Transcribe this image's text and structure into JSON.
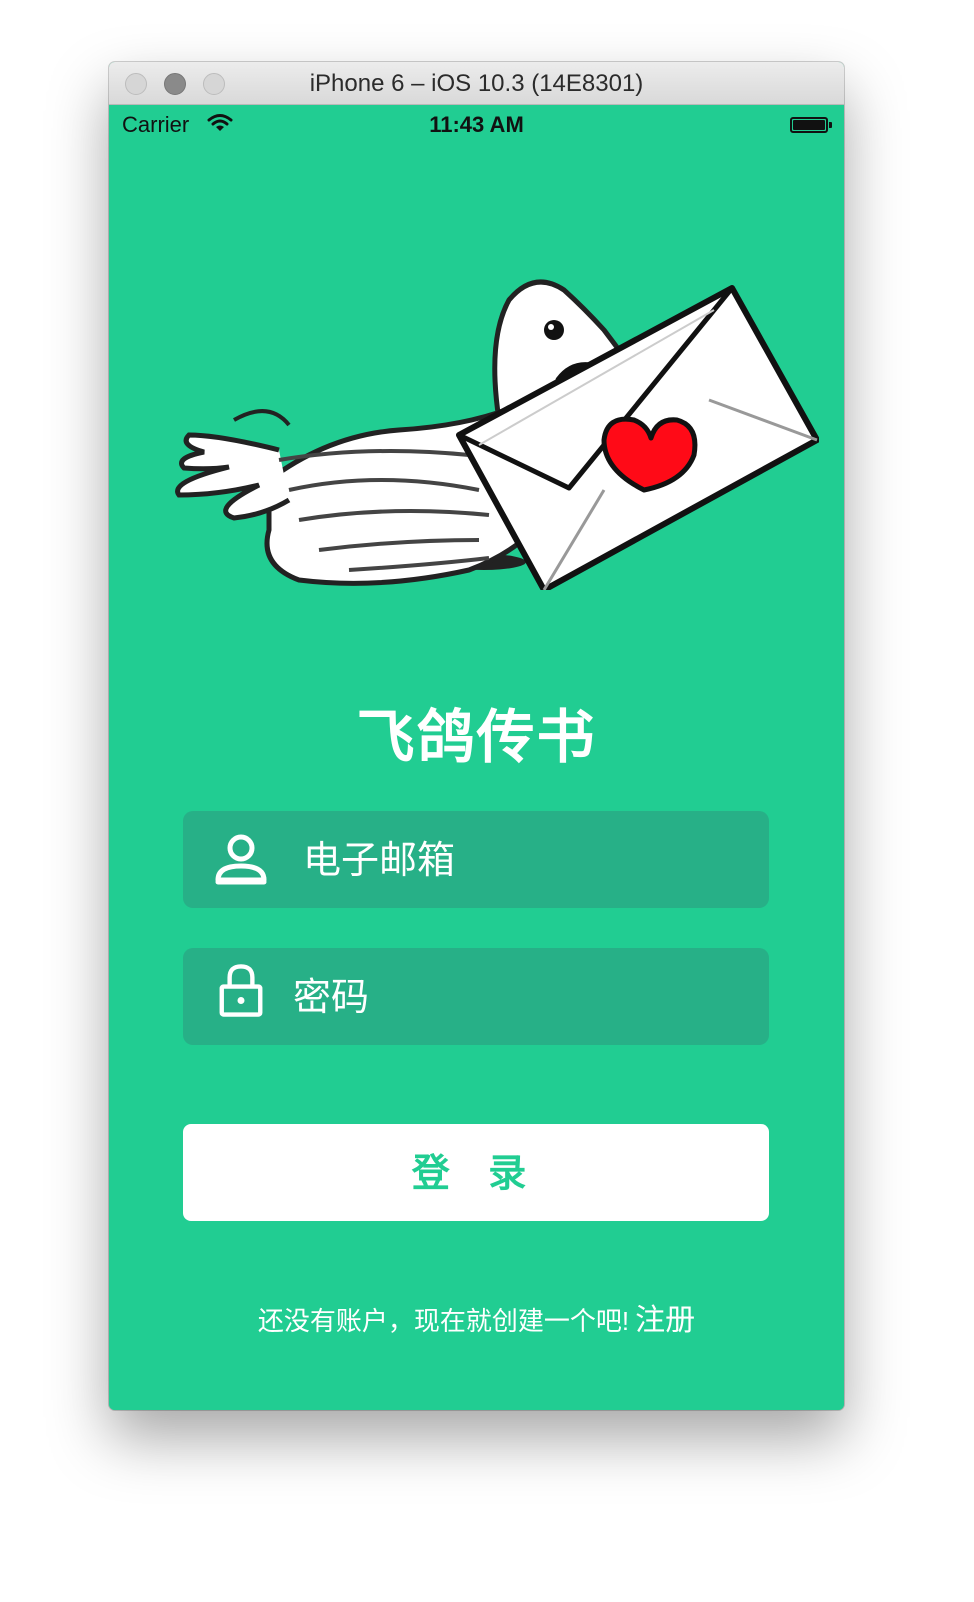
{
  "window": {
    "title": "iPhone 6 – iOS 10.3 (14E8301)"
  },
  "status_bar": {
    "carrier": "Carrier",
    "time": "11:43 AM"
  },
  "app": {
    "title": "飞鸽传书",
    "email_field": {
      "placeholder": "电子邮箱",
      "icon": "user-icon"
    },
    "password_field": {
      "placeholder": "密码",
      "icon": "lock-icon"
    },
    "login_button": "登 录",
    "signup_prompt": "还没有账户，现在就创建一个吧!",
    "signup_link": "注册"
  },
  "colors": {
    "background": "#21cd92",
    "field_background": "#27b087",
    "button_background": "#ffffff",
    "button_text": "#21cd92",
    "heart": "#ff0a17"
  }
}
